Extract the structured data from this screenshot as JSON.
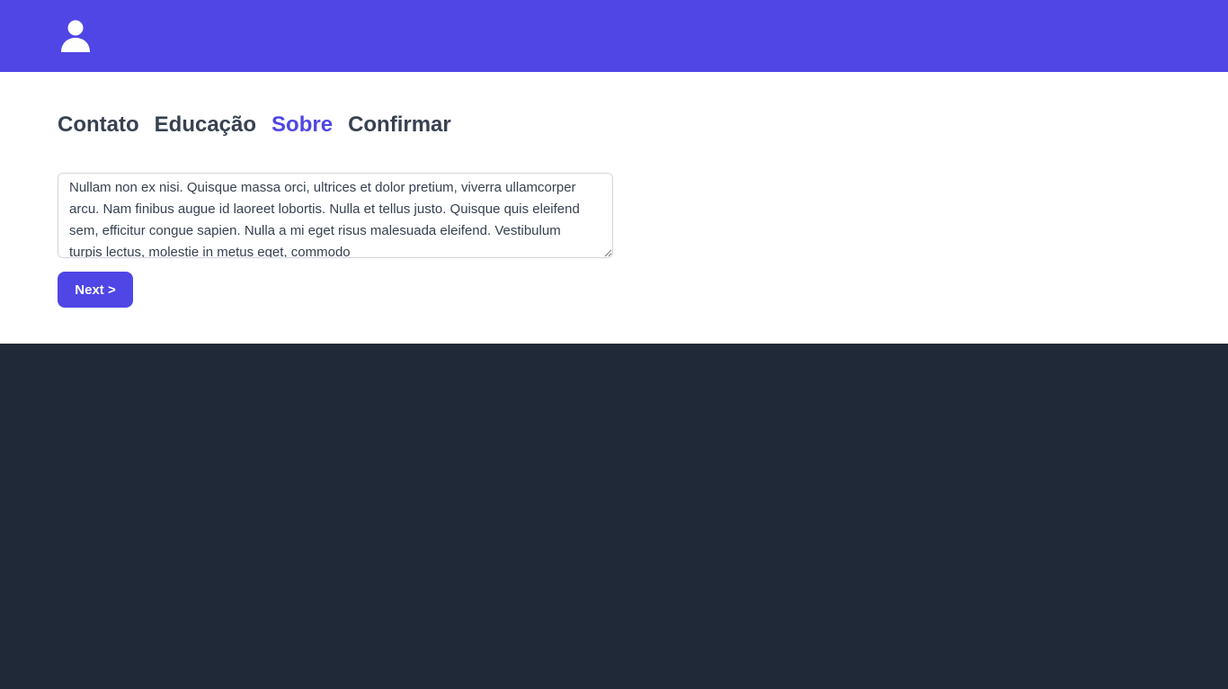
{
  "header": {
    "icon": "user-icon",
    "background_color": "#4f46e5"
  },
  "tabs": [
    {
      "label": "Contato",
      "active": false
    },
    {
      "label": "Educação",
      "active": false
    },
    {
      "label": "Sobre",
      "active": true
    },
    {
      "label": "Confirmar",
      "active": false
    }
  ],
  "about": {
    "text": "Nullam non ex nisi. Quisque massa orci, ultrices et dolor pretium, viverra ullamcorper arcu. Nam finibus augue id laoreet lobortis. Nulla et tellus justo. Quisque quis eleifend sem, efficitur congue sapien. Nulla a mi eget risus malesuada eleifend. Vestibulum turpis lectus, molestie in metus eget, commodo"
  },
  "actions": {
    "next_label": "Next >"
  },
  "colors": {
    "accent": "#4f46e5",
    "text": "#374151",
    "footer_background": "#1f2937"
  }
}
